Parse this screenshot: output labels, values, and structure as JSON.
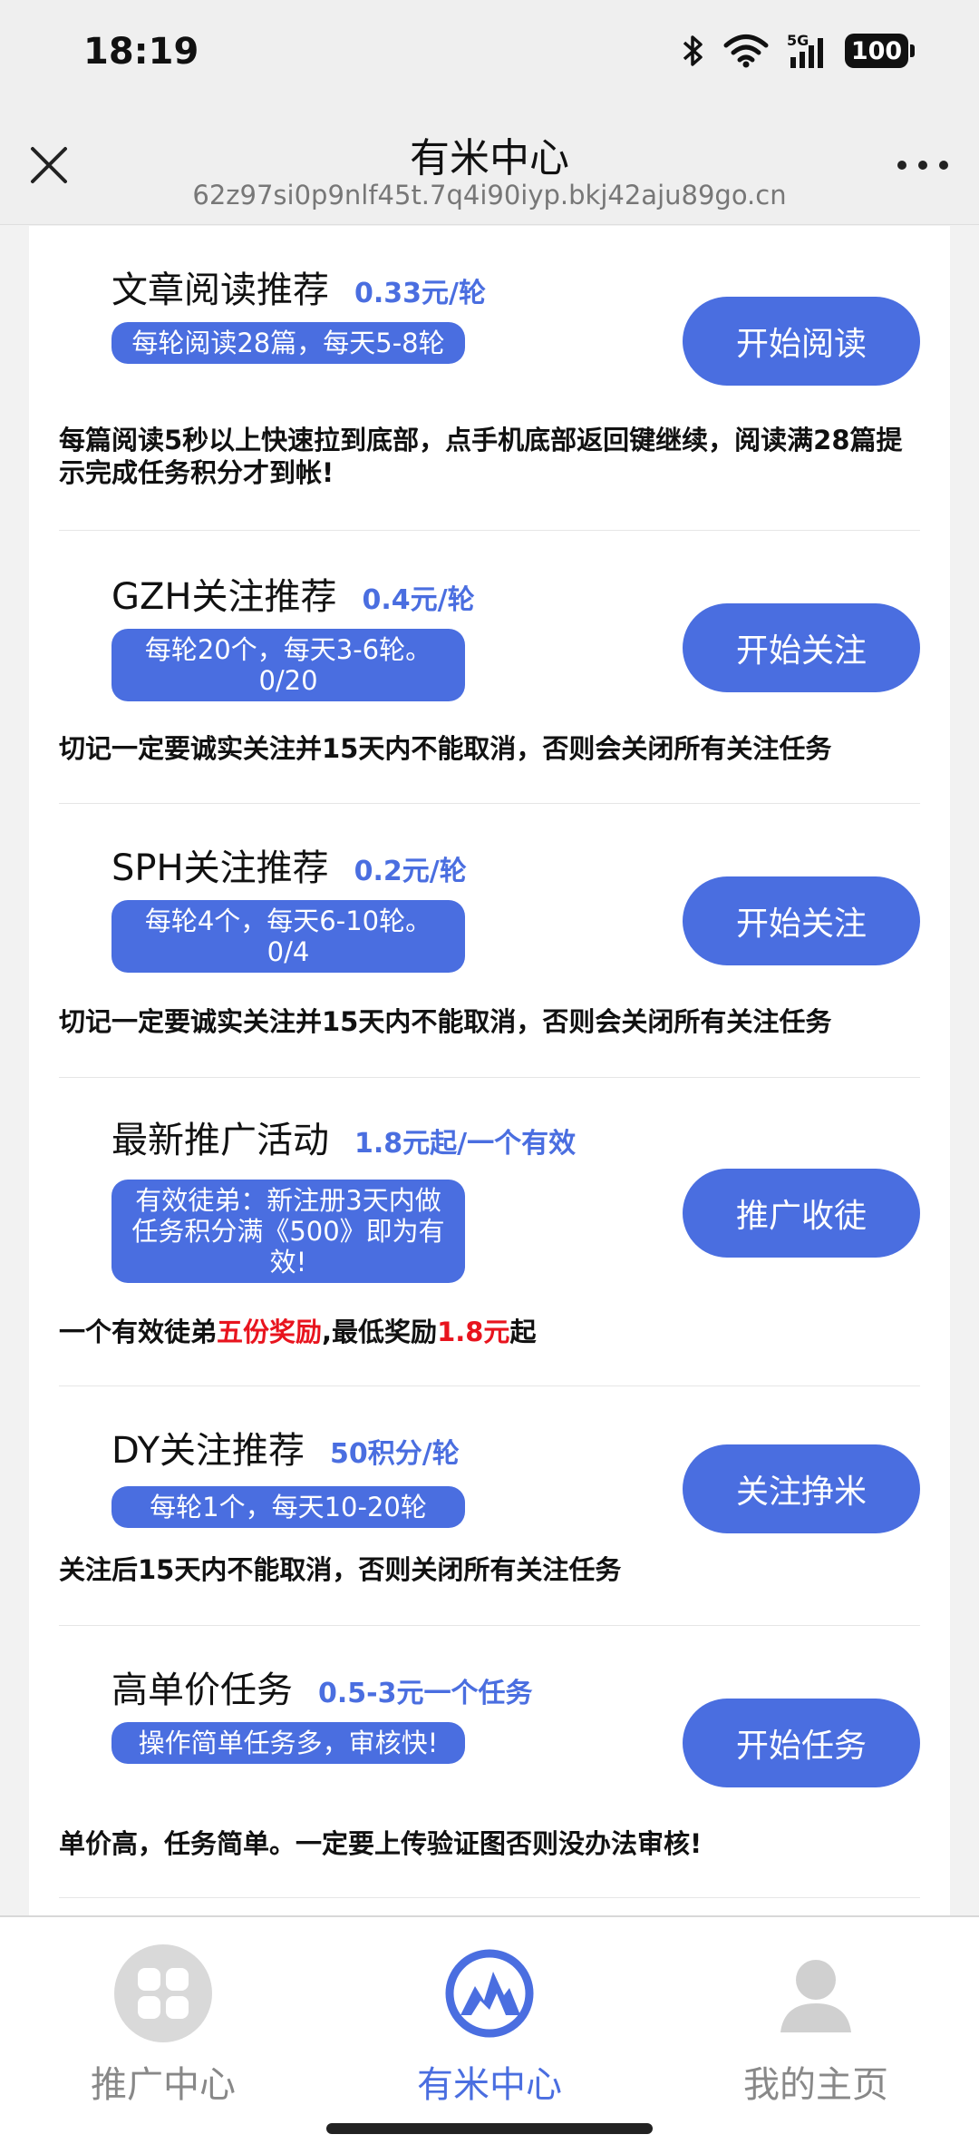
{
  "status_bar": {
    "time": "18:19",
    "network": "5G",
    "battery": "100"
  },
  "header": {
    "title": "有米中心",
    "url": "62z97si0p9nlf45t.7q4i90iyp.bkj42aju89go.cn"
  },
  "tasks": [
    {
      "title": "文章阅读推荐",
      "price": "0.33元/轮",
      "tag": "每轮阅读28篇，每天5-8轮",
      "button": "开始阅读",
      "desc": "每篇阅读5秒以上快速拉到底部，点手机底部返回键继续，阅读满28篇提示完成任务积分才到帐!"
    },
    {
      "title": "GZH关注推荐",
      "price": "0.4元/轮",
      "tag": "每轮20个，每天3-6轮。0/20",
      "button": "开始关注",
      "desc": "切记一定要诚实关注并15天内不能取消，否则会关闭所有关注任务"
    },
    {
      "title": "SPH关注推荐",
      "price": "0.2元/轮",
      "tag": "每轮4个，每天6-10轮。0/4",
      "button": "开始关注",
      "desc": "切记一定要诚实关注并15天内不能取消，否则会关闭所有关注任务"
    },
    {
      "title": "最新推广活动",
      "price": "1.8元起/一个有效",
      "tag": "有效徒弟：新注册3天内做任务积分满《500》即为有效!",
      "button": "推广收徒",
      "desc_parts": [
        "一个有效徒弟",
        "五份奖励",
        ",最低奖励",
        "1.8元",
        "起"
      ]
    },
    {
      "title": "DY关注推荐",
      "price": "50积分/轮",
      "tag": "每轮1个，每天10-20轮",
      "button": "关注挣米",
      "desc": "关注后15天内不能取消，否则关闭所有关注任务"
    },
    {
      "title": "高单价任务",
      "price": "0.5-3元一个任务",
      "tag": "操作简单任务多，审核快!",
      "button": "开始任务",
      "desc": "单价高，任务简单。一定要上传验证图否则没办法审核!"
    }
  ],
  "tabbar": {
    "items": [
      {
        "label": "推广中心",
        "icon": "grid-icon"
      },
      {
        "label": "有米中心",
        "icon": "mountain-logo-icon"
      },
      {
        "label": "我的主页",
        "icon": "user-icon"
      }
    ],
    "active": "有米中心",
    "accent_color": "#4a6ee0"
  }
}
